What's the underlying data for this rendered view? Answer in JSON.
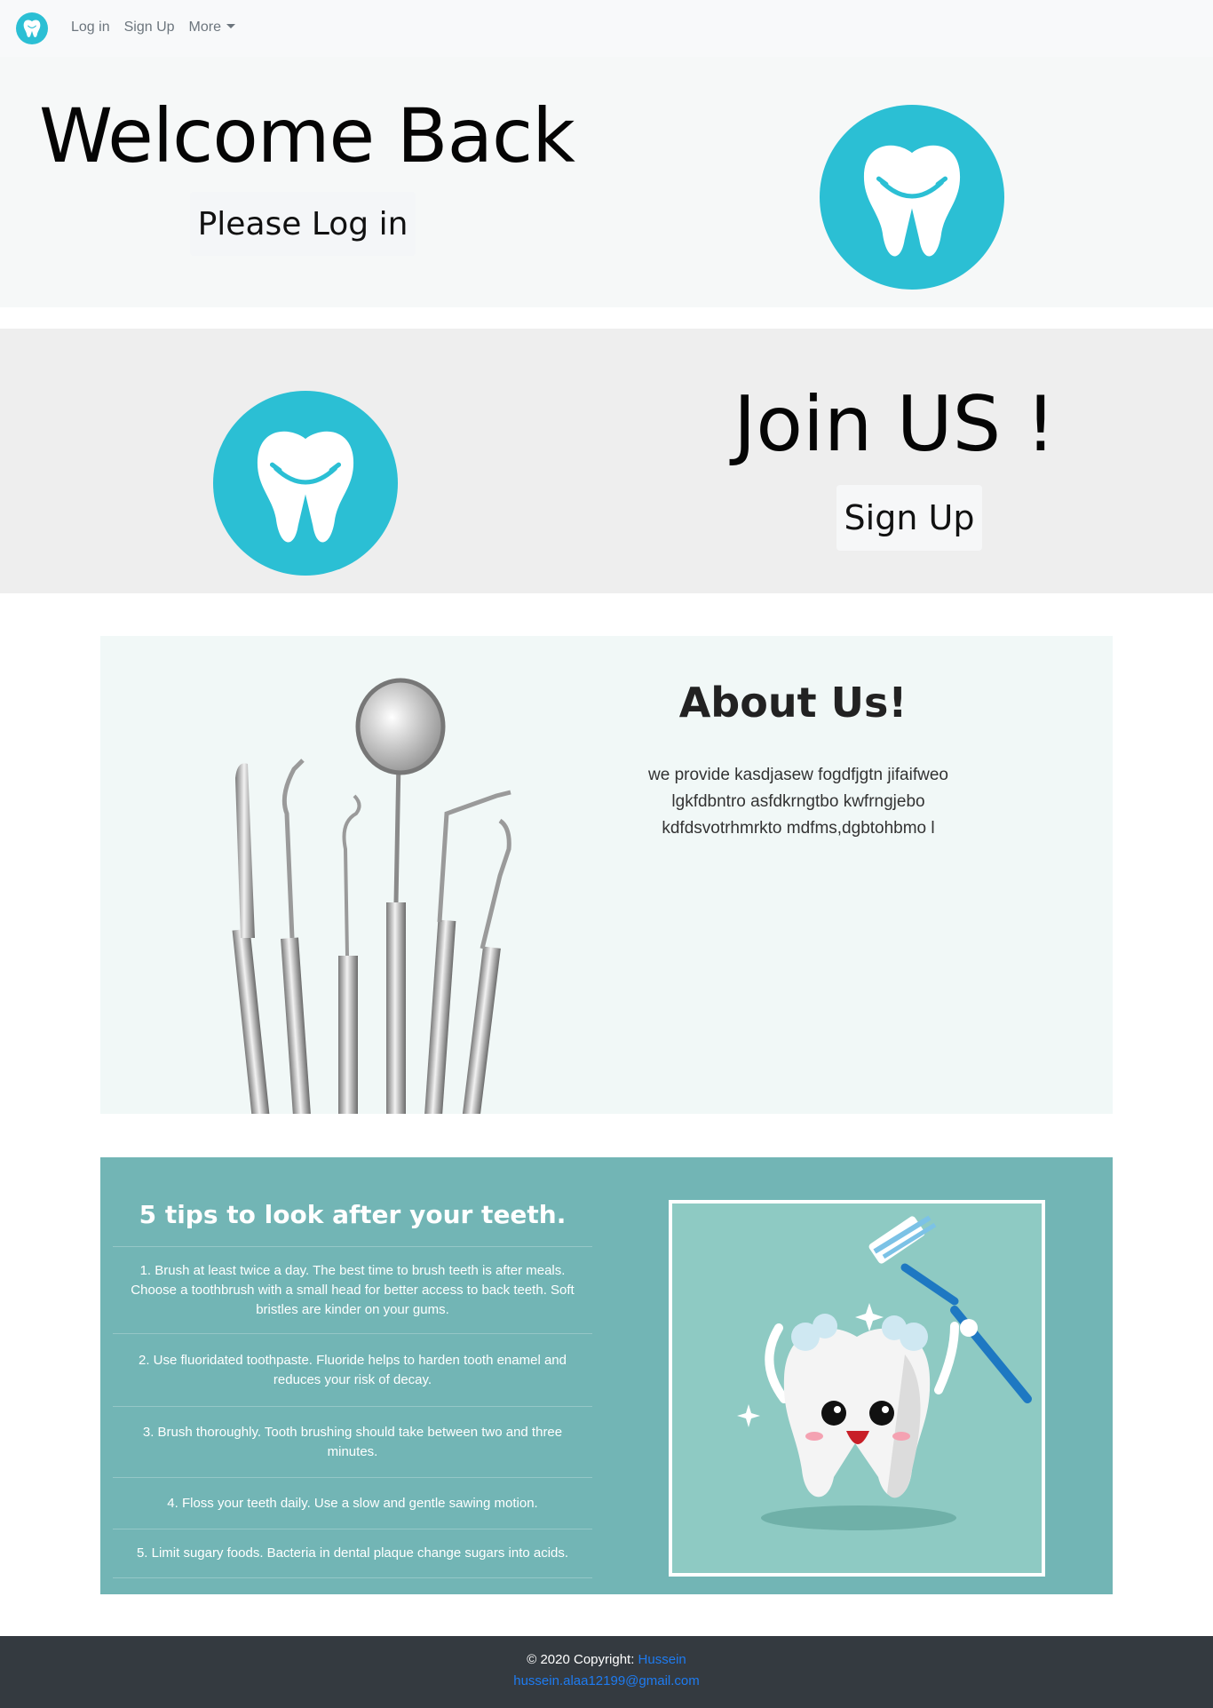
{
  "nav": {
    "logo_icon": "tooth-icon",
    "links": [
      {
        "label": "Log in"
      },
      {
        "label": "Sign Up"
      },
      {
        "label": "More"
      }
    ]
  },
  "hero_login": {
    "title": "Welcome Back",
    "button_label": "Please Log in"
  },
  "hero_signup": {
    "title": "Join US !",
    "button_label": "Sign Up"
  },
  "about": {
    "title": "About Us!",
    "text": "we provide kasdjasew fogdfjgtn jifaifweo lgkfdbntro asfdkrngtbo kwfrngjebo kdfdsvotrhmrkto mdfms,dgbtohbmo l"
  },
  "tips": {
    "title": "5 tips to look after your teeth.",
    "items": [
      "1. Brush at least twice a day. The best time to brush teeth is after meals. Choose a toothbrush with a small head for better access to back teeth. Soft bristles are kinder on your gums.",
      "2. Use fluoridated toothpaste. Fluoride helps to harden tooth enamel and reduces your risk of decay.",
      "3. Brush thoroughly. Tooth brushing should take between two and three minutes.",
      "4. Floss your teeth daily. Use a slow and gentle sawing motion.",
      "5. Limit sugary foods. Bacteria in dental plaque change sugars into acids."
    ]
  },
  "footer": {
    "copyright": "© 2020 Copyright: ",
    "author": "Hussein",
    "email": "hussein.alaa12199@gmail.com"
  },
  "colors": {
    "brand_teal": "#2bbfd4",
    "tips_bg": "#72b5b5",
    "footer_bg": "#343a40",
    "link_blue": "#1e7bf0"
  }
}
